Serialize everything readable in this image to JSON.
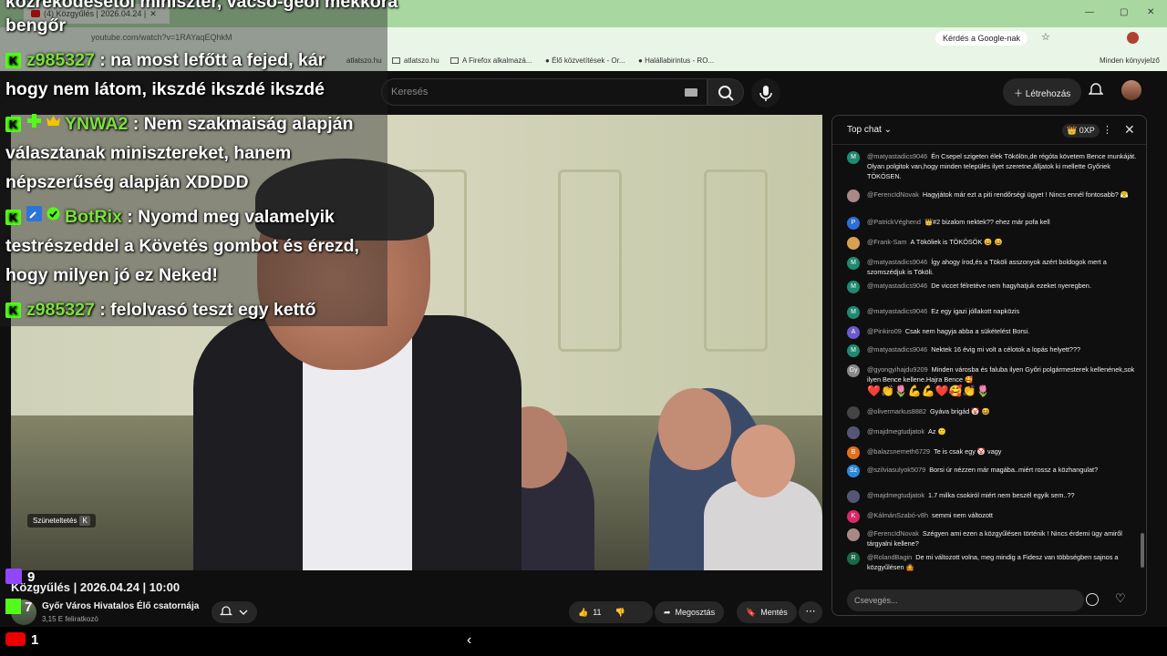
{
  "browser": {
    "tab_title": "(4) Közgyűlés | 2026.04.24 |",
    "url": "youtube.com/watch?v=1RAYaqEQhkM",
    "ask_google": "Kérdés a Google-nak",
    "bookmarks": [
      "atlatszo.hu",
      "atlatszo.hu",
      "A Firefox alkalmazá...",
      "Élő közvetítések - Or...",
      "Halállabirintus - RO..."
    ],
    "right_bookmarks": "Minden könyvjelző"
  },
  "masthead": {
    "search_placeholder": "Keresés",
    "create_label": "Létrehozás"
  },
  "overlay": {
    "top_fragment": "közreködésétől miniszter, vácso-geol mekkora",
    "top_fragment2": "bengőr",
    "messages": [
      {
        "user": "z985327",
        "text": ": na most lefőtt a fejed, kár",
        "cont": "hogy nem látom, ikszdé ikszdé ikszdé"
      },
      {
        "user": "YNWA2",
        "text": ": Nem szakmaiság alapján",
        "cont": "választanak minisztereket, hanem",
        "cont2": "népszerűség alapján XDDDD"
      },
      {
        "user": "BotRix",
        "text": ": Nyomd meg valamelyik",
        "cont": "testrészeddel a Követés gombot és érezd,",
        "cont2": "hogy milyen jó ez Neked!"
      },
      {
        "user": "z985327",
        "text": ": felolvasó teszt egy kettő"
      }
    ],
    "viewers": {
      "twitch": "9",
      "kick": "7",
      "youtube": "1"
    }
  },
  "video": {
    "pause_label": "Szüneteltetés",
    "pause_key": "K",
    "title": "Közgyűlés | 2026.04.24 | 10:00",
    "channel": "Győr Város Hivatalos Élő csatornája",
    "subscribers": "3,15 E feliratkozó",
    "likes": "11",
    "share": "Megosztás",
    "save": "Mentés"
  },
  "chat": {
    "mode": "Top chat",
    "xp": "0XP",
    "input_placeholder": "Csevegés...",
    "messages": [
      {
        "author": "@matyastadics9046",
        "text": "Én Csepel szigeten élek Tökölön,de régóta követem Bence munkáját. Olyan polgitok van,hogy minden település ilyet szeretne,álljatok ki mellette Győriek TÖKÖSEN.",
        "av": "M",
        "color": "#1f8a70"
      },
      {
        "author": "@FerencIdNovak",
        "text": "Hagyjátok már ezt a piti rendőrségi ügyet ! Nincs ennél fontosabb? 😤",
        "av": "",
        "color": "#a88"
      },
      {
        "author": "@PatrickVéghend",
        "text": "👑#2  bizalom nektek?? ehez már pofa kell",
        "av": "P",
        "color": "#2d6fd8"
      },
      {
        "author": "@Frank-Sam",
        "text": "A Tököliek is TÖKÖSÖK 😀 😀",
        "av": "",
        "color": "#d8a050"
      },
      {
        "author": "@matyastadics9046",
        "text": "Így ahogy írod,és a Tököli asszonyok azért boldogok mert a szomszédjuk is Tököli.",
        "av": "M",
        "color": "#1f8a70"
      },
      {
        "author": "@matyastadics9046",
        "text": "De viccet félretéve nem hagyhatjuk ezeket nyeregben.",
        "av": "M",
        "color": "#1f8a70"
      },
      {
        "author": "@matyastadics9046",
        "text": "Ez egy igazi jóllakott napközis",
        "av": "M",
        "color": "#1f8a70"
      },
      {
        "author": "@Pinkiro09",
        "text": "Csak nem hagyja abba a sükételést Borsi.",
        "av": "A",
        "color": "#6a5acd"
      },
      {
        "author": "@matyastadics9046",
        "text": "Nektek 16 évig mi volt a célotok a lopás helyett???",
        "av": "M",
        "color": "#1f8a70"
      },
      {
        "author": "@gyongyihajdu9209",
        "text": "Minden városba és faluba ilyen Győri polgármesterek kellenének,sok ilyen Bence kellene.Hajra Bence 🥰",
        "av": "Gy",
        "color": "#888"
      },
      {
        "author": "",
        "text": "❤️👏🌷💪💪❤️🥰👏🌷",
        "av": "",
        "color": ""
      },
      {
        "author": "@olivermarkus8882",
        "text": "Gyáva brigád 🤡 😆",
        "av": "",
        "color": "#444"
      },
      {
        "author": "@majdmegtudjatok",
        "text": "Az 🙂",
        "av": "",
        "color": "#557"
      },
      {
        "author": "@balazsnemeth6729",
        "text": "Te is csak egy 🤡 vagy",
        "av": "B",
        "color": "#e07020"
      },
      {
        "author": "@szilviasulyok5079",
        "text": "Borsi úr nézzen már magába..miért rossz a közhangulat?",
        "av": "Sz",
        "color": "#2a8ad8"
      },
      {
        "author": "@majdmegtudjatok",
        "text": "1.7 milka csokiról miért nem beszél egyik sem..??",
        "av": "",
        "color": "#557"
      },
      {
        "author": "@KálmánSzabó-v8h",
        "text": "semmi nem változott",
        "av": "K",
        "color": "#d82a6a"
      },
      {
        "author": "@FerencIdNovak",
        "text": "Szégyen ami ezen a közgyűlésen történik ! Nincs érdemi ügy amiről tárgyalni kellene?",
        "av": "",
        "color": "#a88"
      },
      {
        "author": "@RolandBagin",
        "text": "De mi változott volna, meg mindig a Fidesz van többségben sajnos a közgyűlésen 🤷",
        "av": "R",
        "color": "#1a6a4a"
      }
    ]
  }
}
